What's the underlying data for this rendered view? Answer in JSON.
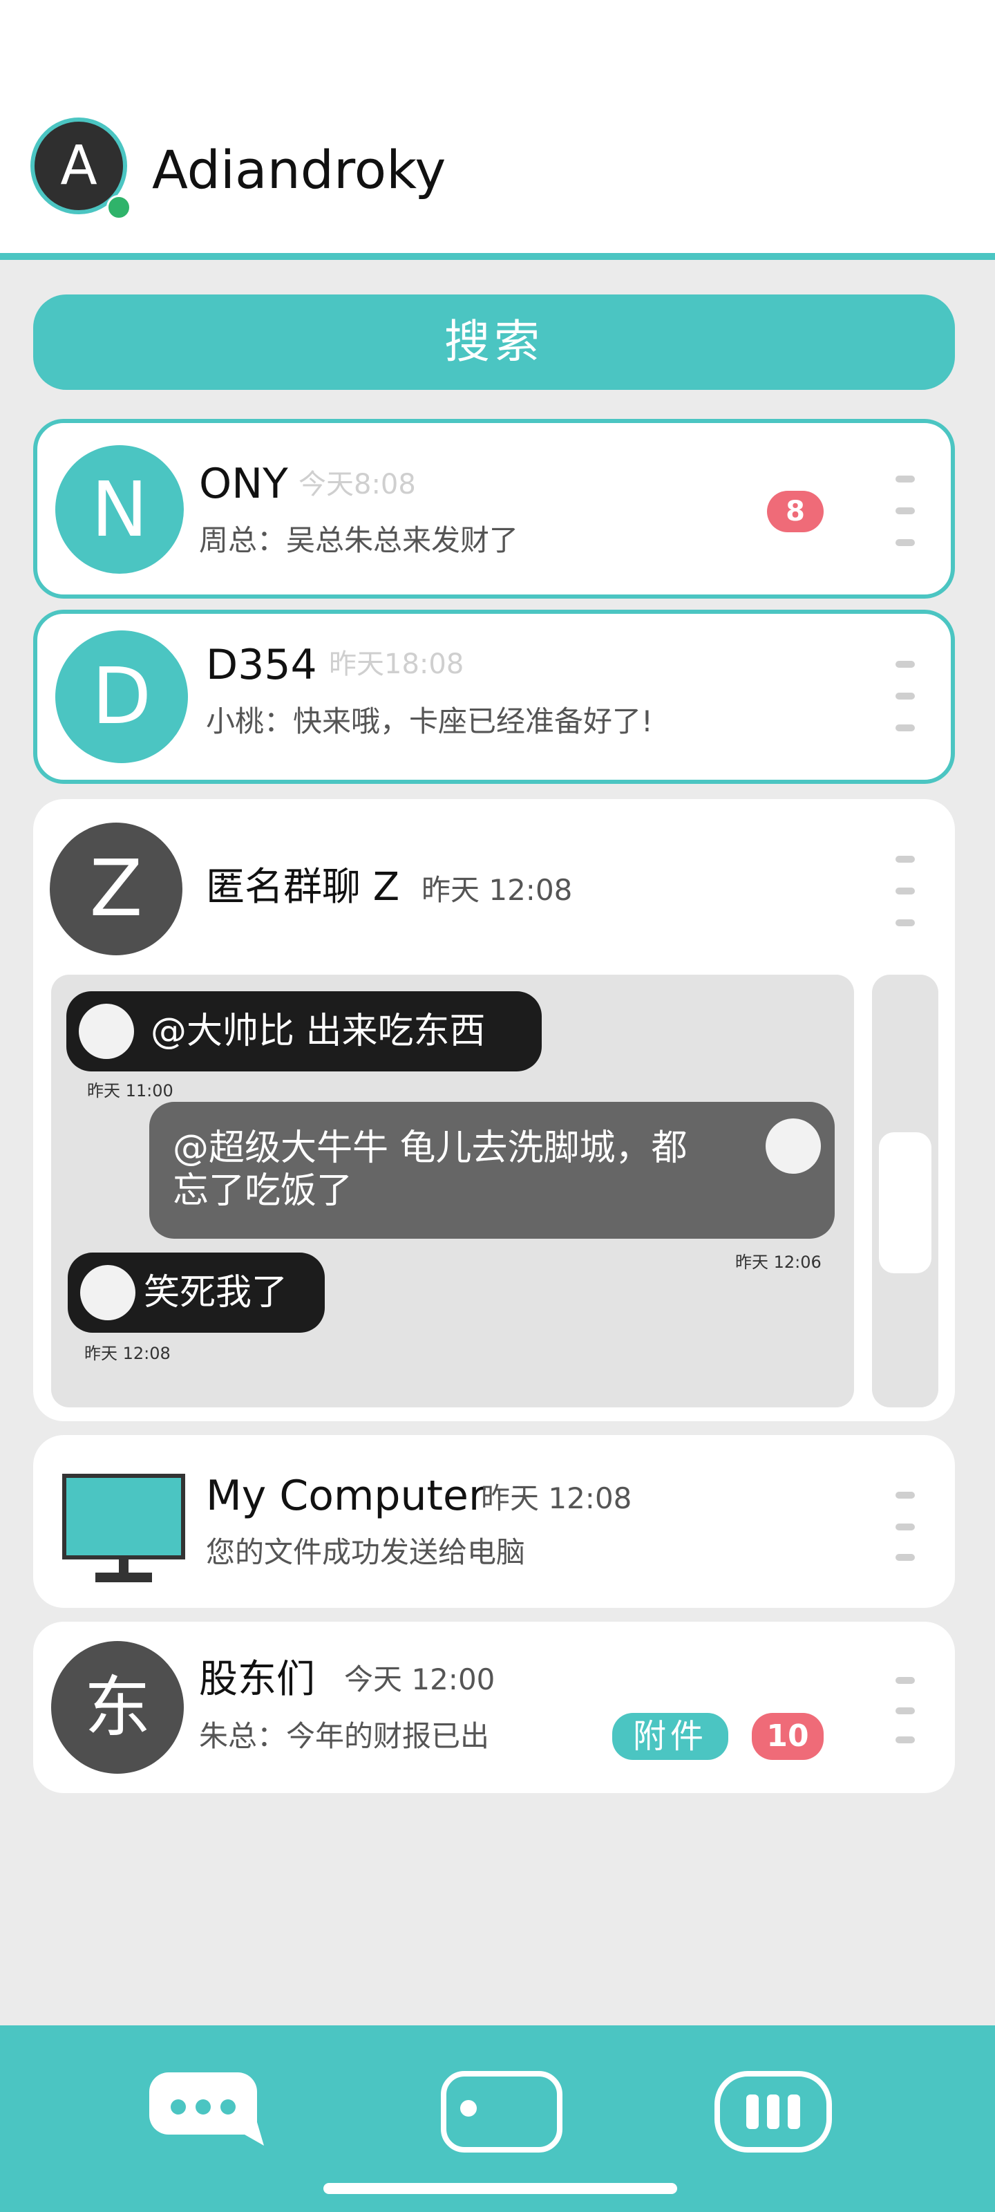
{
  "profile": {
    "avatar_letter": "A",
    "name": "Adiandroky",
    "status_color": "#2fb36a"
  },
  "search": {
    "label": "搜索"
  },
  "theme": {
    "accent": "#4bc5c2",
    "badge": "#ef6b78",
    "dark_avatar": "#4f4f4f"
  },
  "chats": [
    {
      "avatar": "N",
      "title": "ONY",
      "time": "今天8:08",
      "preview": "周总：吴总朱总来发财了",
      "unread": "8"
    },
    {
      "avatar": "D",
      "title": "D354",
      "time": "昨天18:08",
      "preview": "小桃：快来哦，卡座已经准备好了!"
    },
    {
      "avatar": "Z",
      "title": "匿名群聊 Z",
      "time": "昨天 12:08",
      "messages": [
        {
          "text": "@大帅比 出来吃东西",
          "time": "昨天 11:00",
          "side": "left"
        },
        {
          "text_line1": "@超级大牛牛 龟儿去洗脚城，都",
          "text_line2": "忘了吃饭了",
          "time": "昨天 12:06",
          "side": "right"
        },
        {
          "text": "笑死我了",
          "time": "昨天 12:08",
          "side": "left"
        }
      ]
    },
    {
      "icon": "monitor-icon",
      "title": "My Computer",
      "time": "昨天 12:08",
      "preview": "您的文件成功发送给电脑"
    },
    {
      "avatar": "东",
      "title": "股东们",
      "time": "今天 12:00",
      "preview": "朱总：今年的财报已出",
      "attachment_label": "附件",
      "unread": "10"
    }
  ],
  "nav": {
    "items": [
      {
        "icon": "chat-bubble-icon"
      },
      {
        "icon": "contacts-card-icon"
      },
      {
        "icon": "apps-bars-icon"
      }
    ]
  }
}
